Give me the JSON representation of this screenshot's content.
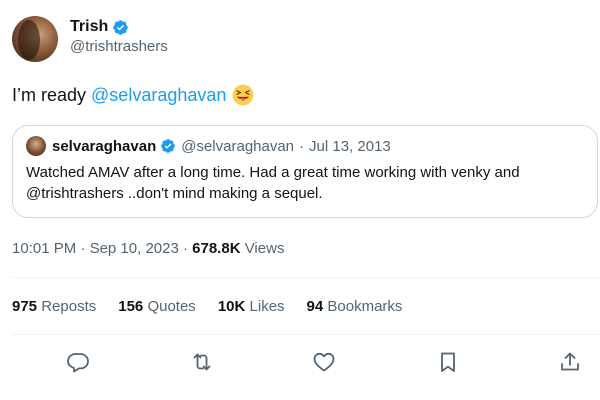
{
  "author": {
    "display_name": "Trish",
    "handle": "@trishtrashers"
  },
  "tweet": {
    "text_prefix": "I’m ready",
    "mention": "@selvaraghavan",
    "emoji": "squinting-face-with-tongue-emoji"
  },
  "quoted_tweet": {
    "display_name": "selvaraghavan",
    "handle": "@selvaraghavan",
    "separator": "·",
    "date": "Jul 13, 2013",
    "line1": "Watched AMAV after a long time. Had a great time working with venky and",
    "line2": "@trishtrashers ..don't mind making a sequel."
  },
  "meta": {
    "time": "10:01 PM",
    "sep1": "·",
    "date": "Sep 10, 2023",
    "sep2": "·",
    "views_count": "678.8K",
    "views_label": "Views"
  },
  "stats": {
    "reposts_count": "975",
    "reposts_label": "Reposts",
    "quotes_count": "156",
    "quotes_label": "Quotes",
    "likes_count": "10K",
    "likes_label": "Likes",
    "bookmarks_count": "94",
    "bookmarks_label": "Bookmarks"
  },
  "icons": {
    "reply": "reply-icon",
    "repost": "repost-icon",
    "like": "heart-icon",
    "bookmark": "bookmark-icon",
    "share": "share-icon"
  },
  "colors": {
    "link": "#1d9bf0",
    "verified": "#1d9bf0",
    "secondary_text": "#536471"
  }
}
